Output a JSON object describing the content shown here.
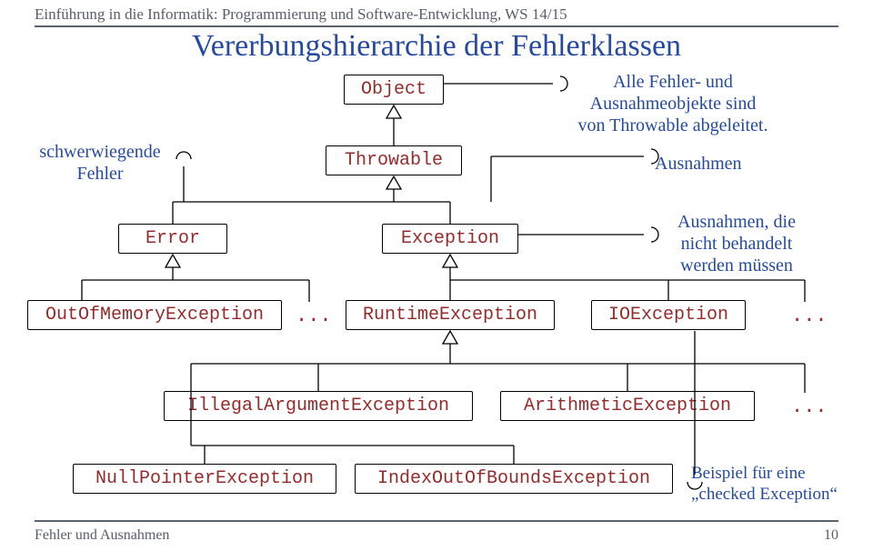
{
  "header": "Einführung in die Informatik: Programmierung und Software-Entwicklung, WS 14/15",
  "title": "Vererbungshierarchie der Fehlerklassen",
  "footer_left": "Fehler und Ausnahmen",
  "footer_right": "10",
  "classes": {
    "object": "Object",
    "throwable": "Throwable",
    "error": "Error",
    "exception": "Exception",
    "out_of_memory": "OutOfMemoryException",
    "runtime": "RuntimeException",
    "ioexception": "IOException",
    "illegal_argument": "IllegalArgumentException",
    "arithmetic": "ArithmeticException",
    "null_pointer": "NullPointerException",
    "index_oob": "IndexOutOfBoundsException"
  },
  "ellipsis": "...",
  "notes": {
    "inherit_l1": "Alle Fehler- und",
    "inherit_l2": "Ausnahmeobjekte sind",
    "inherit_l3": "von Throwable abgeleitet.",
    "severe_l1": "schwerwiegende",
    "severe_l2": "Fehler",
    "ausnahmen": "Ausnahmen",
    "unchecked_l1": "Ausnahmen, die",
    "unchecked_l2": "nicht behandelt",
    "unchecked_l3": "werden müssen",
    "checked_l1": "Beispiel für eine",
    "checked_l2": "„checked Exception“"
  },
  "chart_data": {
    "type": "diagram",
    "description": "UML-style inheritance hierarchy of Java error/exception classes",
    "root": "Object",
    "edges": [
      [
        "Throwable",
        "Object"
      ],
      [
        "Error",
        "Throwable"
      ],
      [
        "Exception",
        "Throwable"
      ],
      [
        "OutOfMemoryException",
        "Error"
      ],
      [
        "...",
        "Error"
      ],
      [
        "RuntimeException",
        "Exception"
      ],
      [
        "IOException",
        "Exception"
      ],
      [
        "...",
        "Exception"
      ],
      [
        "IllegalArgumentException",
        "RuntimeException"
      ],
      [
        "ArithmeticException",
        "RuntimeException"
      ],
      [
        "...",
        "RuntimeException"
      ],
      [
        "NullPointerException",
        "RuntimeException"
      ],
      [
        "IndexOutOfBoundsException",
        "RuntimeException"
      ]
    ],
    "annotations": [
      {
        "target": "Object",
        "text": "Alle Fehler- und Ausnahmeobjekte sind von Throwable abgeleitet."
      },
      {
        "target": "Error",
        "text": "schwerwiegende Fehler"
      },
      {
        "target": "Exception",
        "text": "Ausnahmen"
      },
      {
        "target": "RuntimeException",
        "text": "Ausnahmen, die nicht behandelt werden müssen"
      },
      {
        "target": "IOException",
        "text": "Beispiel für eine „checked Exception“"
      }
    ]
  }
}
